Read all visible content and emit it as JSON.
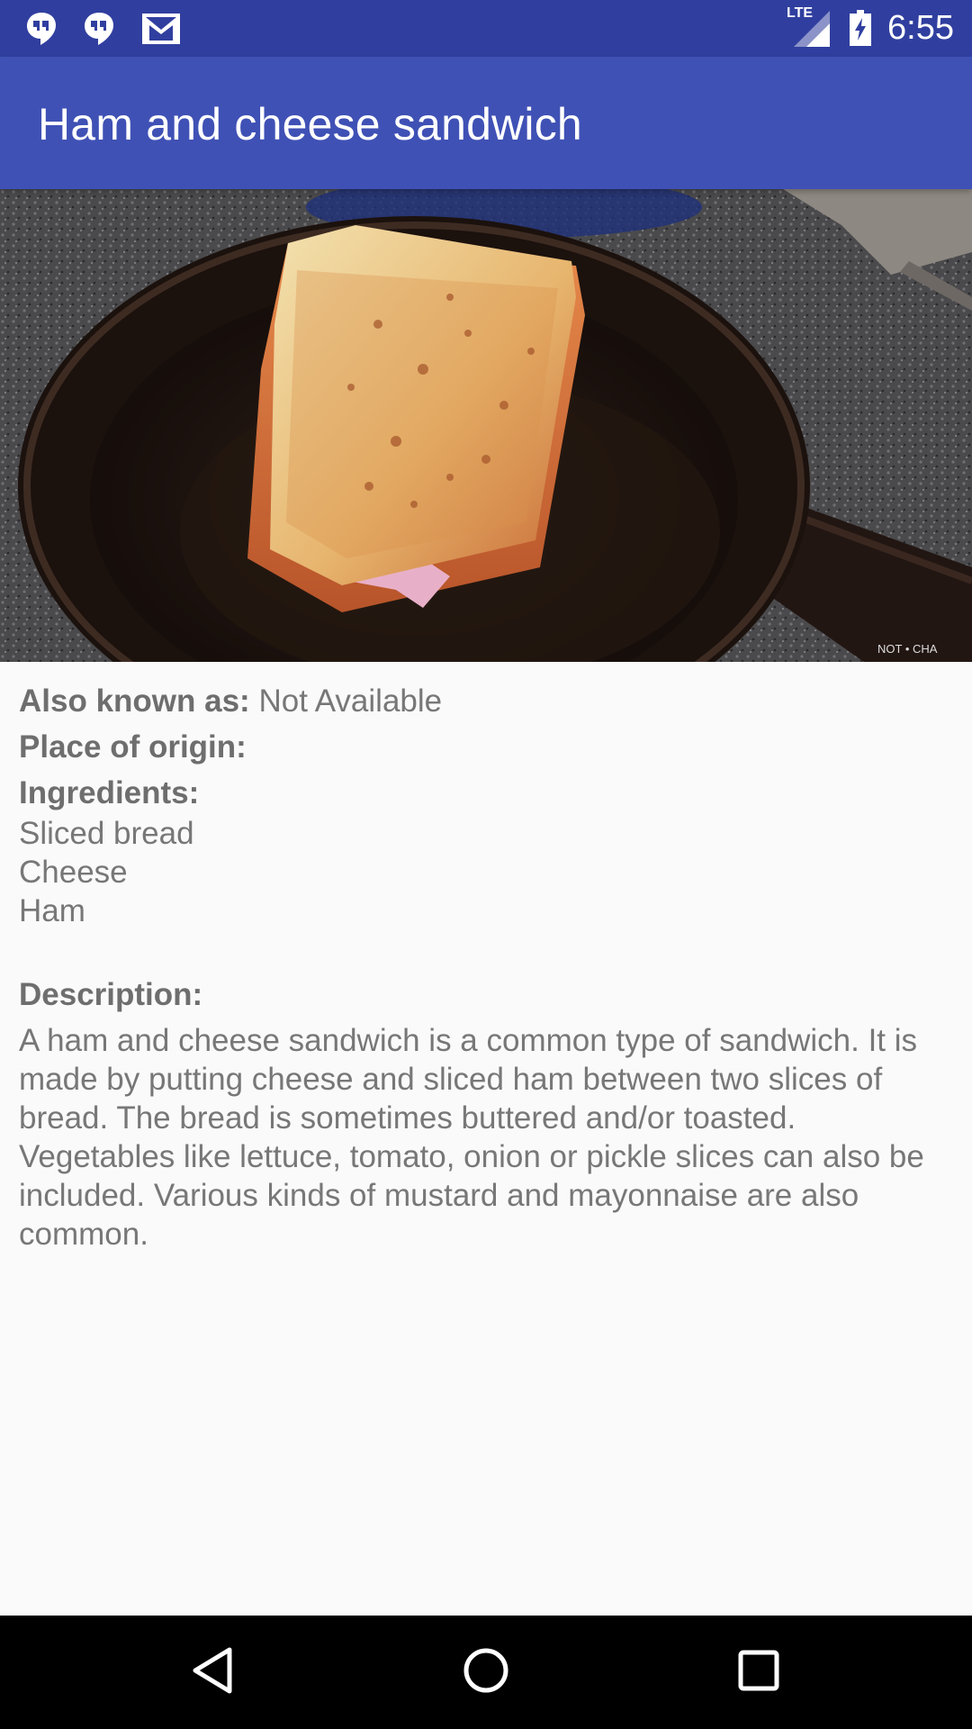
{
  "status_bar": {
    "time": "6:55",
    "network": "LTE",
    "icons": [
      "hangouts-icon",
      "hangouts-icon",
      "gmail-icon",
      "lte-signal-icon",
      "battery-charging-icon"
    ]
  },
  "app_bar": {
    "title": "Ham and cheese sandwich"
  },
  "hero": {
    "watermark": "NOT • CHA"
  },
  "details": {
    "also_known_label": "Also known as:",
    "also_known_value": "Not Available",
    "origin_label": "Place of origin:",
    "origin_value": "",
    "ingredients_label": "Ingredients:",
    "ingredients": [
      "Sliced bread",
      "Cheese",
      "Ham"
    ],
    "description_label": "Description:",
    "description": "A ham and cheese sandwich is a common type of sandwich. It is made by putting cheese and sliced ham between two slices of bread. The bread is sometimes buttered and/or toasted. Vegetables like lettuce, tomato, onion or pickle slices can also be included. Various kinds of mustard and mayonnaise are also common."
  },
  "nav_bar": {
    "icons": [
      "back-icon",
      "home-icon",
      "recents-icon"
    ]
  },
  "colors": {
    "status_bar": "#303f9f",
    "app_bar": "#3f51b5",
    "text": "#737373"
  }
}
